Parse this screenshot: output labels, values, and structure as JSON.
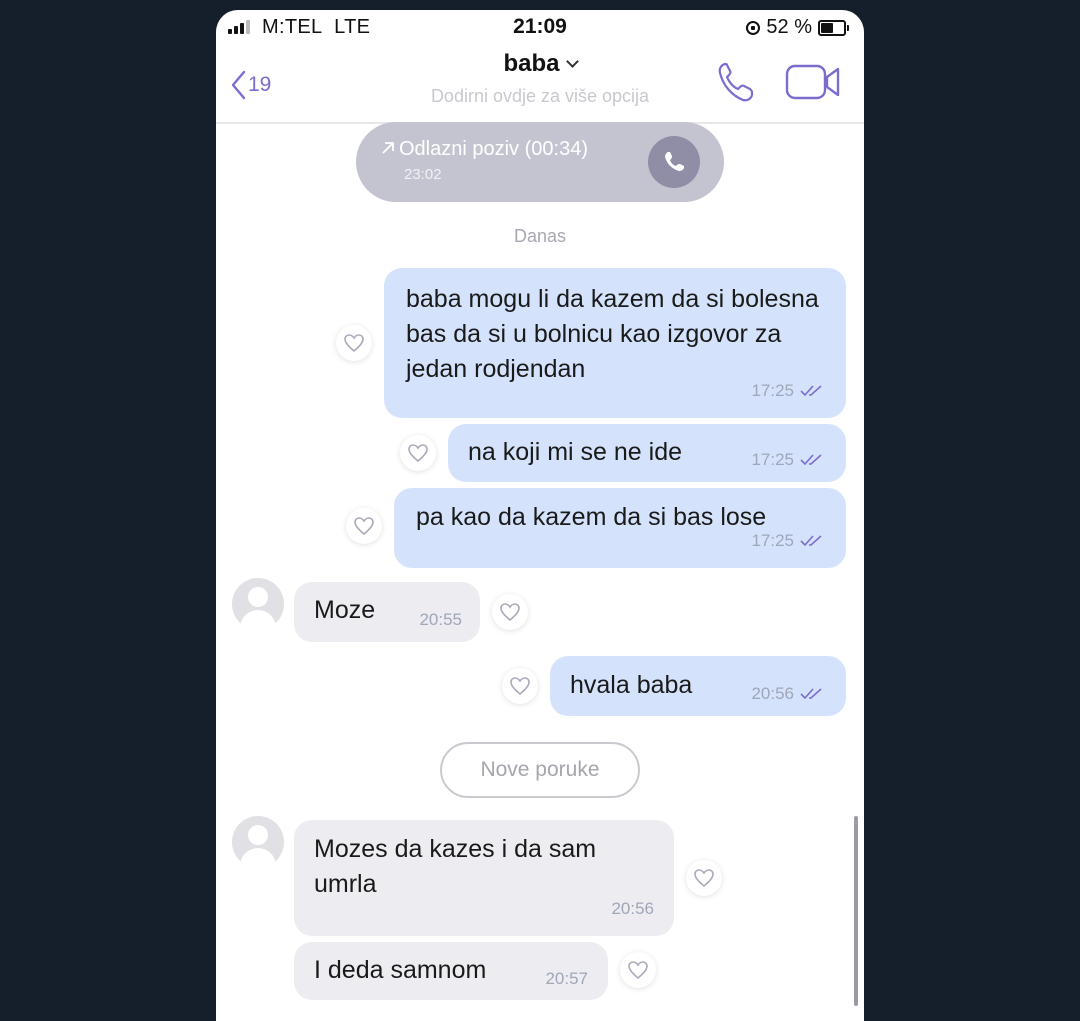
{
  "status_bar": {
    "carrier": "M:TEL",
    "network": "LTE",
    "time": "21:09",
    "battery": "52 %"
  },
  "header": {
    "back_count": "19",
    "contact_name": "baba",
    "subtitle": "Dodirni ovdje za više opcija"
  },
  "call": {
    "label": "Odlazni poziv (00:34)",
    "time": "23:02"
  },
  "date_separator": "Danas",
  "messages": [
    {
      "direction": "outgoing",
      "text": "baba mogu li da kazem da si bolesna bas da si u bolnicu kao izgovor za jedan rodjendan",
      "time": "17:25"
    },
    {
      "direction": "outgoing",
      "text": "na koji mi se ne ide",
      "time": "17:25"
    },
    {
      "direction": "outgoing",
      "text": "pa kao da kazem da si bas lose",
      "time": "17:25"
    },
    {
      "direction": "incoming",
      "text": "Moze",
      "time": "20:55"
    },
    {
      "direction": "outgoing",
      "text": "hvala baba",
      "time": "20:56"
    },
    {
      "direction": "incoming",
      "text": "Mozes da kazes i da sam umrla",
      "time": "20:56"
    },
    {
      "direction": "incoming",
      "text": "I deda samnom",
      "time": "20:57"
    }
  ],
  "new_messages_label": "Nove poruke",
  "colors": {
    "accent": "#7b6cce",
    "outgoing_bubble": "#d4e3fb",
    "incoming_bubble": "#ededf1",
    "background": "#151f2c"
  }
}
